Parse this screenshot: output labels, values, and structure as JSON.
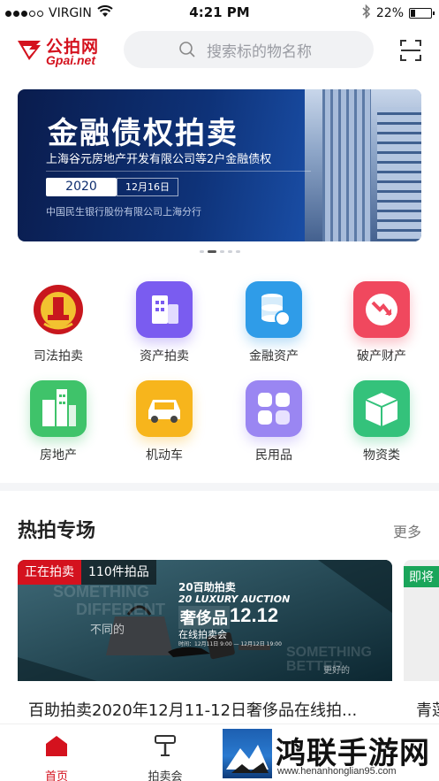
{
  "status_bar": {
    "carrier": "VIRGIN",
    "time": "4:21 PM",
    "battery": "22%",
    "battery_level": 0.22
  },
  "header": {
    "logo_cn": "公拍网",
    "logo_en": "Gpai.net",
    "search_placeholder": "搜索标的物名称"
  },
  "banner": {
    "title": "金融债权拍卖",
    "subtitle": "上海谷元房地产开发有限公司等2户金融债权",
    "year": "2020",
    "date": "12月16日",
    "bank": "中国民生银行股份有限公司上海分行",
    "page_count": 5,
    "active_page": 1
  },
  "categories": [
    {
      "label": "司法拍卖",
      "icon": "court-emblem-icon",
      "color": "#c8171e"
    },
    {
      "label": "资产拍卖",
      "icon": "building-icon",
      "color": "#7a5cf0"
    },
    {
      "label": "金融资产",
      "icon": "coins-icon",
      "color": "#2f9ce8"
    },
    {
      "label": "破产财产",
      "icon": "downtrend-icon",
      "color": "#f0485e"
    },
    {
      "label": "房地产",
      "icon": "city-icon",
      "color": "#3fc36a"
    },
    {
      "label": "机动车",
      "icon": "car-icon",
      "color": "#f7b51c"
    },
    {
      "label": "民用品",
      "icon": "grid-icon",
      "color": "#9a86f2"
    },
    {
      "label": "物资类",
      "icon": "box-icon",
      "color": "#34c27b"
    }
  ],
  "hot": {
    "title": "热拍专场",
    "more": "更多",
    "cards": [
      {
        "status": "正在拍卖",
        "count": "110件拍品",
        "name": "百助拍卖2020年12月11-12日奢侈品在线拍...",
        "poster": {
          "line1": "20百助拍卖",
          "line2": "20 LUXURY AUCTION",
          "big": "奢侈品",
          "date": "12.12",
          "online": "在线拍卖会",
          "time": "时间：12月11日 9:00 — 12月12日 19:00",
          "something": "SOMETHING",
          "different": "DIFFERENT",
          "butong": "不同的",
          "better": "BETTER",
          "genghao": "更好的"
        }
      },
      {
        "status": "即将",
        "name": "青莲"
      }
    ]
  },
  "tabs": [
    {
      "label": "首页",
      "active": true
    },
    {
      "label": "拍卖会",
      "active": false
    }
  ],
  "watermark": {
    "name": "鸿联手游网",
    "url": "www.henanhonglian95.com"
  }
}
